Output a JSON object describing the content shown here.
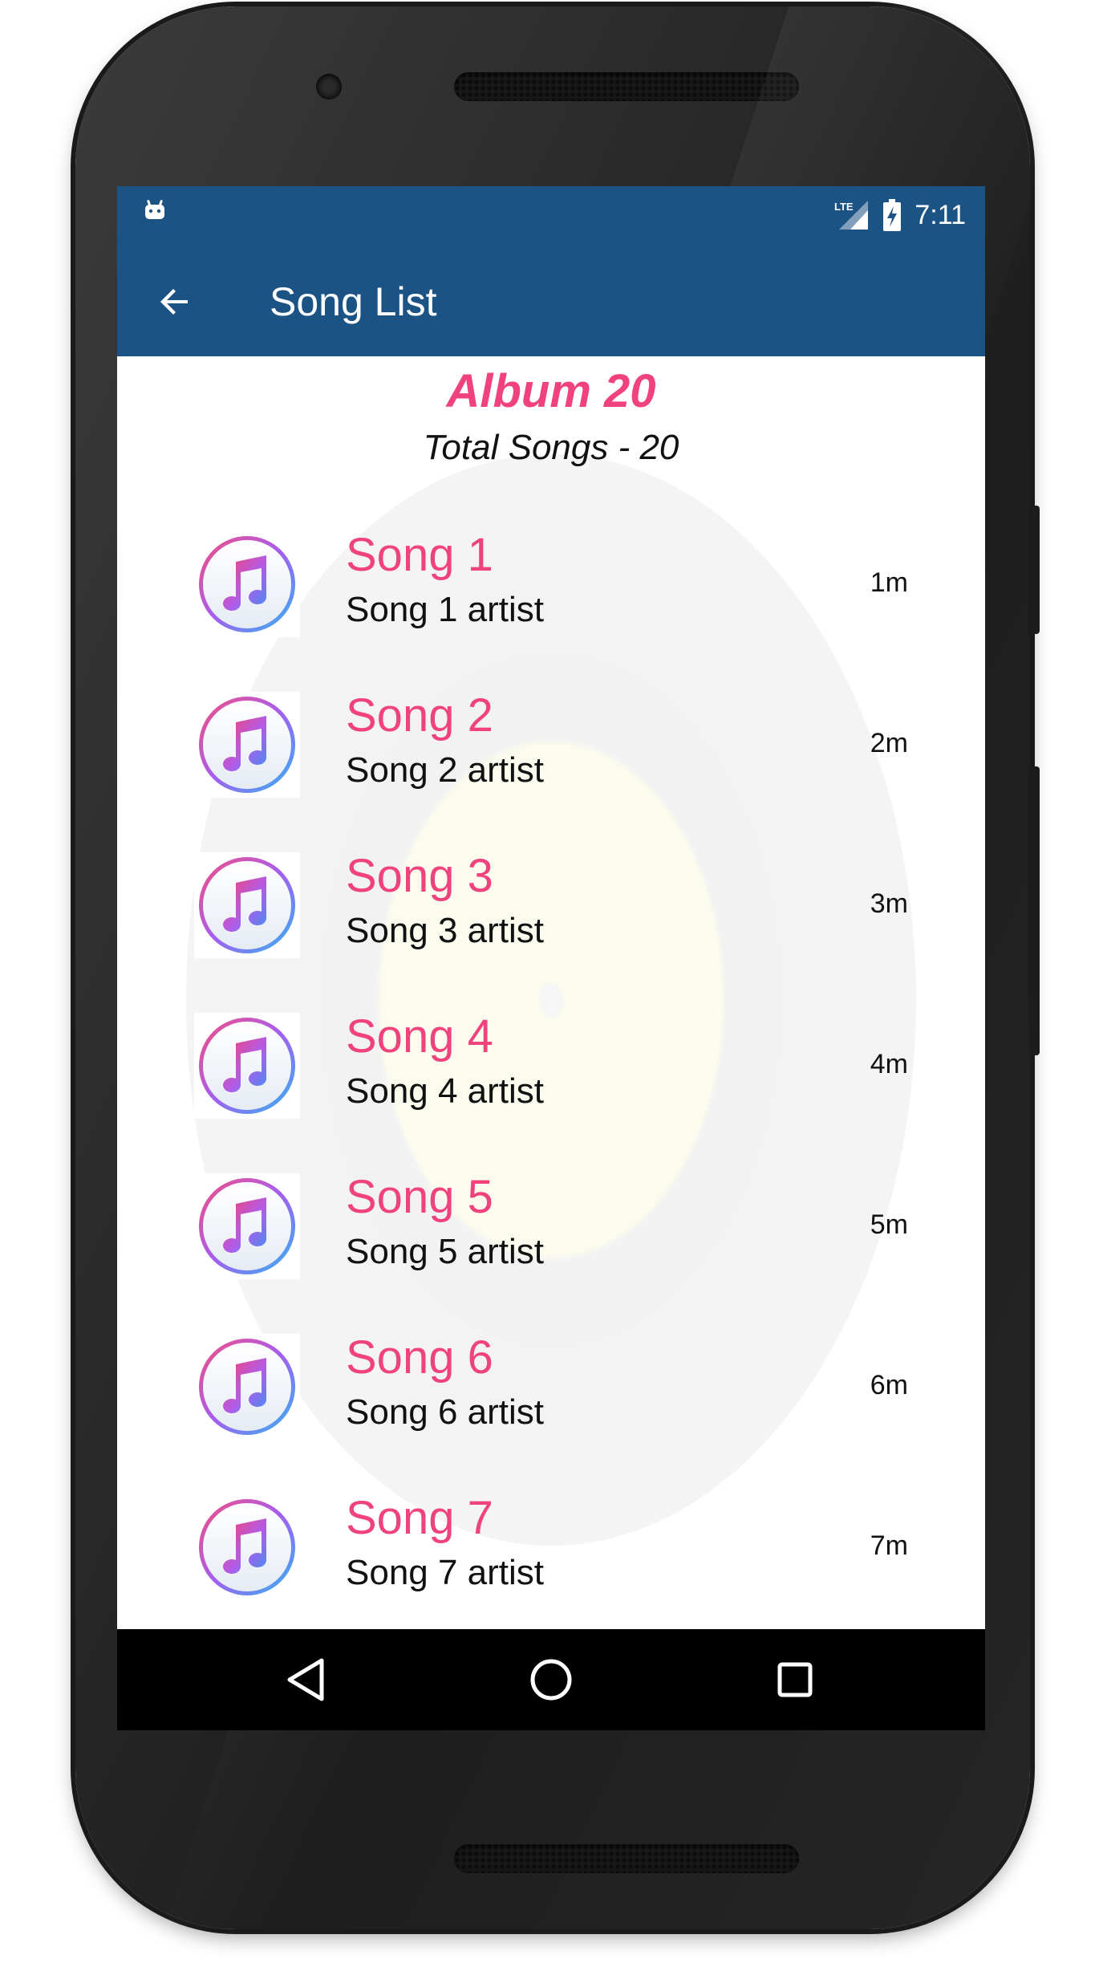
{
  "statusbar": {
    "time": "7:11",
    "network_label": "LTE",
    "icons": [
      "android-notification-icon",
      "lte-signal-icon",
      "battery-charging-icon"
    ]
  },
  "toolbar": {
    "title": "Song List",
    "back_icon": "arrow-left-icon"
  },
  "album": {
    "title": "Album 20",
    "total_songs": "Total Songs - 20"
  },
  "songs": [
    {
      "title": "Song 1",
      "artist": "Song 1 artist",
      "duration": "1m"
    },
    {
      "title": "Song 2",
      "artist": "Song 2 artist",
      "duration": "2m"
    },
    {
      "title": "Song 3",
      "artist": "Song 3 artist",
      "duration": "3m"
    },
    {
      "title": "Song 4",
      "artist": "Song 4 artist",
      "duration": "4m"
    },
    {
      "title": "Song 5",
      "artist": "Song 5 artist",
      "duration": "5m"
    },
    {
      "title": "Song 6",
      "artist": "Song 6 artist",
      "duration": "6m"
    },
    {
      "title": "Song 7",
      "artist": "Song 7 artist",
      "duration": "7m"
    }
  ],
  "navbar": {
    "icons": [
      "nav-back-icon",
      "nav-home-icon",
      "nav-recents-icon"
    ]
  },
  "colors": {
    "toolbar": "#1c5385",
    "accent": "#f0437e",
    "text": "#111111",
    "navbar": "#000000"
  }
}
